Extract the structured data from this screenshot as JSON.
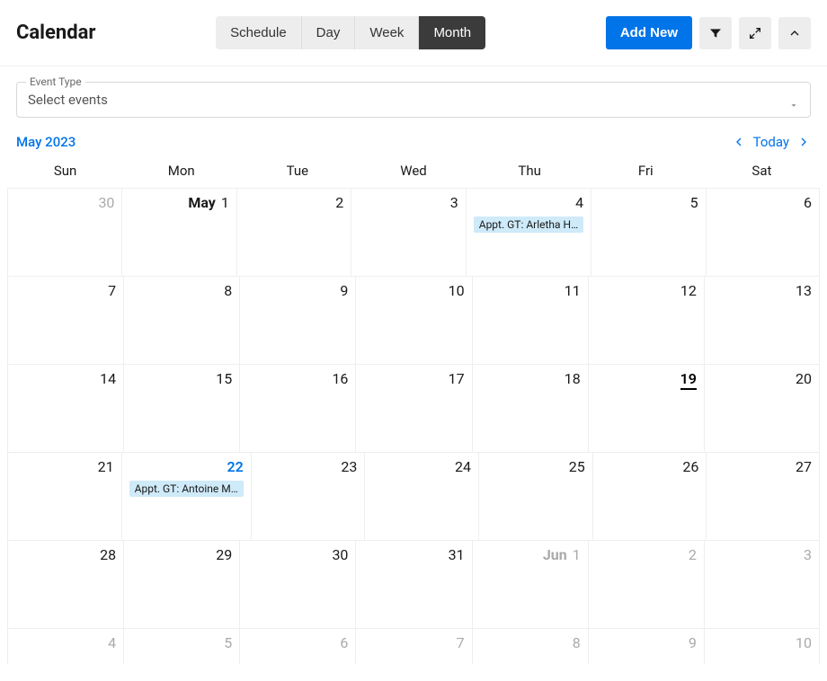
{
  "header": {
    "title": "Calendar",
    "views": {
      "schedule": "Schedule",
      "day": "Day",
      "week": "Week",
      "month": "Month",
      "active": "month"
    },
    "add_new": "Add New",
    "icons": {
      "filter": "filter-icon",
      "expand": "expand-icon",
      "collapse": "chevron-up-icon"
    }
  },
  "filter": {
    "legend": "Event Type",
    "placeholder": "Select events"
  },
  "subheader": {
    "month_label": "May 2023",
    "today": "Today"
  },
  "calendar": {
    "dow": [
      "Sun",
      "Mon",
      "Tue",
      "Wed",
      "Thu",
      "Fri",
      "Sat"
    ],
    "weeks": [
      [
        {
          "n": "30",
          "other": true
        },
        {
          "n": "1",
          "prefix": "May"
        },
        {
          "n": "2"
        },
        {
          "n": "3"
        },
        {
          "n": "4",
          "events": [
            "Appt. GT: Arletha H…"
          ]
        },
        {
          "n": "5"
        },
        {
          "n": "6"
        }
      ],
      [
        {
          "n": "7"
        },
        {
          "n": "8"
        },
        {
          "n": "9"
        },
        {
          "n": "10"
        },
        {
          "n": "11"
        },
        {
          "n": "12"
        },
        {
          "n": "13"
        }
      ],
      [
        {
          "n": "14"
        },
        {
          "n": "15"
        },
        {
          "n": "16"
        },
        {
          "n": "17"
        },
        {
          "n": "18"
        },
        {
          "n": "19",
          "today": true
        },
        {
          "n": "20"
        }
      ],
      [
        {
          "n": "21"
        },
        {
          "n": "22",
          "selected": true,
          "events": [
            "Appt. GT: Antoine M…"
          ]
        },
        {
          "n": "23"
        },
        {
          "n": "24"
        },
        {
          "n": "25"
        },
        {
          "n": "26"
        },
        {
          "n": "27"
        }
      ],
      [
        {
          "n": "28"
        },
        {
          "n": "29"
        },
        {
          "n": "30"
        },
        {
          "n": "31"
        },
        {
          "n": "1",
          "prefix": "Jun",
          "other": true
        },
        {
          "n": "2",
          "other": true
        },
        {
          "n": "3",
          "other": true
        }
      ],
      [
        {
          "n": "4",
          "other": true
        },
        {
          "n": "5",
          "other": true
        },
        {
          "n": "6",
          "other": true
        },
        {
          "n": "7",
          "other": true
        },
        {
          "n": "8",
          "other": true
        },
        {
          "n": "9",
          "other": true
        },
        {
          "n": "10",
          "other": true
        }
      ]
    ]
  }
}
